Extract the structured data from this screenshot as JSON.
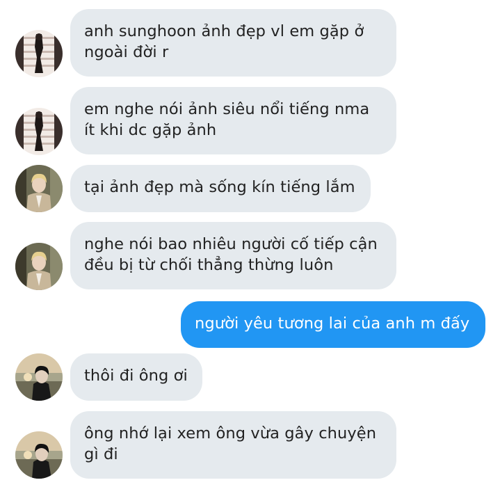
{
  "conversation": {
    "messages": [
      {
        "direction": "in",
        "sender_avatar": "avatar-a",
        "text": "anh sunghoon ảnh đẹp vl em gặp ở\nngoài đời r"
      },
      {
        "direction": "in",
        "sender_avatar": "avatar-a",
        "text": "em nghe nói ảnh siêu nổi tiếng nma\nít khi dc gặp ảnh"
      },
      {
        "direction": "in",
        "sender_avatar": "avatar-b",
        "text": "tại ảnh đẹp mà sống kín tiếng lắm"
      },
      {
        "direction": "in",
        "sender_avatar": "avatar-b",
        "text": "nghe nói bao nhiêu người cố tiếp cận\nđều bị từ chối thẳng thừng luôn"
      },
      {
        "direction": "out",
        "text": "người yêu tương lai của anh m đấy"
      },
      {
        "direction": "in",
        "sender_avatar": "avatar-c",
        "text": "thôi đi ông ơi"
      },
      {
        "direction": "in",
        "sender_avatar": "avatar-c",
        "text": "ông nhớ lại xem ông vừa gây chuyện\ngì đi"
      }
    ]
  },
  "colors": {
    "incoming_bubble": "#e5eaee",
    "outgoing_bubble": "#2196f3",
    "incoming_text": "#222222",
    "outgoing_text": "#ffffff"
  },
  "icons": [
    "avatar-a",
    "avatar-b",
    "avatar-c"
  ]
}
